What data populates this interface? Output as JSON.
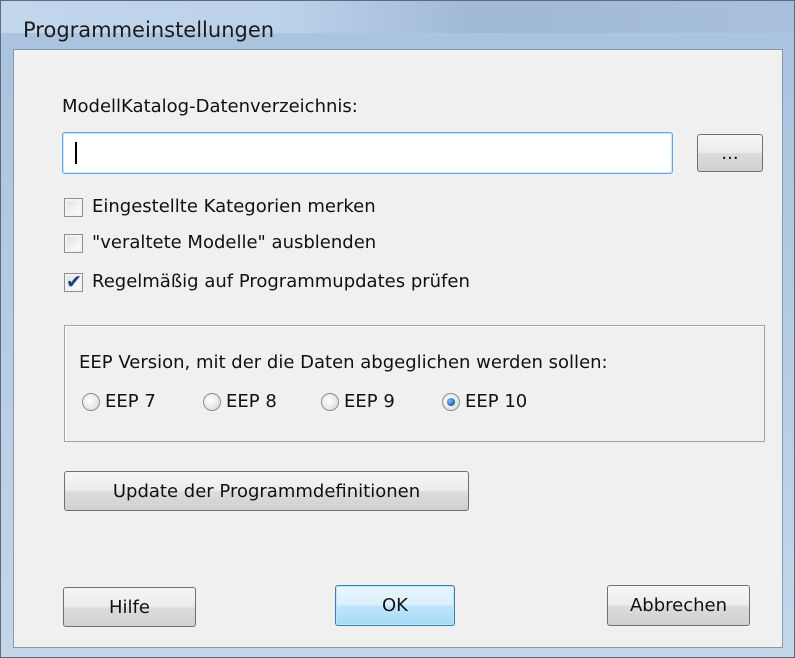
{
  "window": {
    "title": "Programmeinstellungen"
  },
  "catalog": {
    "label": "ModellKatalog-Datenverzeichnis:",
    "path_value": "",
    "browse_label": "..."
  },
  "options": {
    "remember_categories": {
      "label": "Eingestellte Kategorien merken",
      "checked": false
    },
    "hide_outdated": {
      "label": "\"veraltete Modelle\" ausblenden",
      "checked": false
    },
    "check_updates": {
      "label": "Regelmäßig auf Programmupdates prüfen",
      "checked": true
    }
  },
  "eep_group": {
    "label": "EEP Version, mit der die Daten abgeglichen werden sollen:",
    "options": [
      "EEP 7",
      "EEP 8",
      "EEP 9",
      "EEP 10"
    ],
    "selected": "EEP 10"
  },
  "update_button": "Update der Programmdefinitionen",
  "footer": {
    "help": "Hilfe",
    "ok": "OK",
    "cancel": "Abbrechen"
  },
  "colors": {
    "title_bar": "#bcd2ea",
    "client_bg": "#f0f0f0",
    "focus_border": "#5fa4e4",
    "default_button": "#bee6fd"
  }
}
